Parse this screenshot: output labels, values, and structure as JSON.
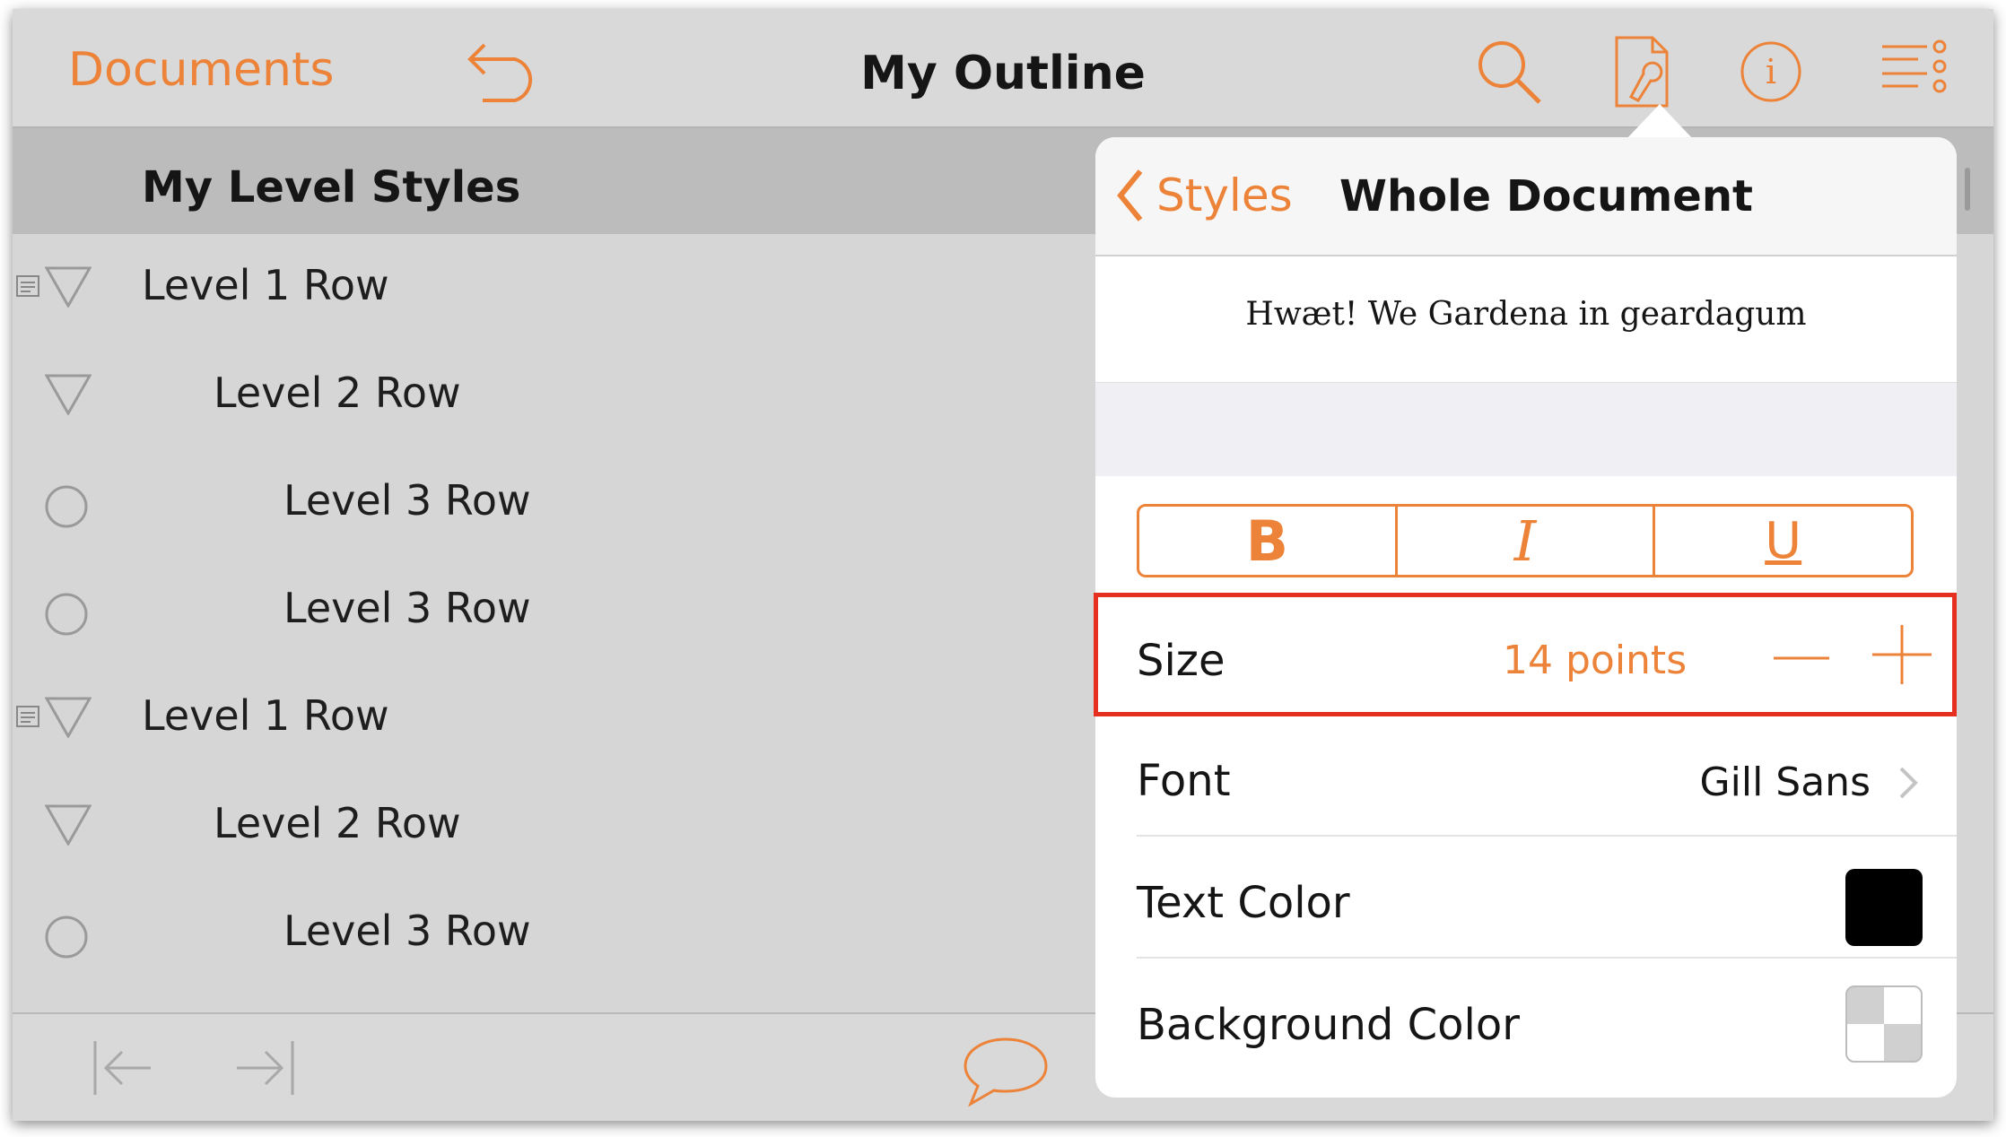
{
  "navbar": {
    "documents_label": "Documents",
    "title": "My Outline",
    "icons": [
      "undo-icon",
      "search-icon",
      "inspector-icon",
      "info-icon",
      "outline-menu-icon"
    ]
  },
  "outline": {
    "section_title": "My Level Styles",
    "rows": [
      {
        "label": "Level 1 Row",
        "level": 1,
        "handle": "disclosure-triangle",
        "has_note": true
      },
      {
        "label": "Level 2 Row",
        "level": 2,
        "handle": "disclosure-triangle",
        "has_note": false
      },
      {
        "label": "Level 3 Row",
        "level": 3,
        "handle": "status-circle",
        "has_note": false
      },
      {
        "label": "Level 3 Row",
        "level": 3,
        "handle": "status-circle",
        "has_note": false
      },
      {
        "label": "Level 1 Row",
        "level": 1,
        "handle": "disclosure-triangle",
        "has_note": true
      },
      {
        "label": "Level 2 Row",
        "level": 2,
        "handle": "disclosure-triangle",
        "has_note": false
      },
      {
        "label": "Level 3 Row",
        "level": 3,
        "handle": "status-circle",
        "has_note": false
      }
    ]
  },
  "toolbar": {
    "icons": [
      "outdent-icon",
      "indent-icon",
      "comment-icon"
    ]
  },
  "popover": {
    "back_label": "Styles",
    "title": "Whole Document",
    "preview_text": "Hwæt! We Gardena in geardagum",
    "style_buttons": {
      "bold": "B",
      "italic": "I",
      "underline": "U"
    },
    "size": {
      "label": "Size",
      "value": "14 points"
    },
    "font": {
      "label": "Font",
      "value": "Gill Sans"
    },
    "text_color": {
      "label": "Text Color",
      "color": "#000000"
    },
    "background_color": {
      "label": "Background Color",
      "color": "transparent"
    }
  },
  "colors": {
    "accent": "#ec8339",
    "highlight": "#e5301f",
    "canvas": "#d6d6d6"
  }
}
